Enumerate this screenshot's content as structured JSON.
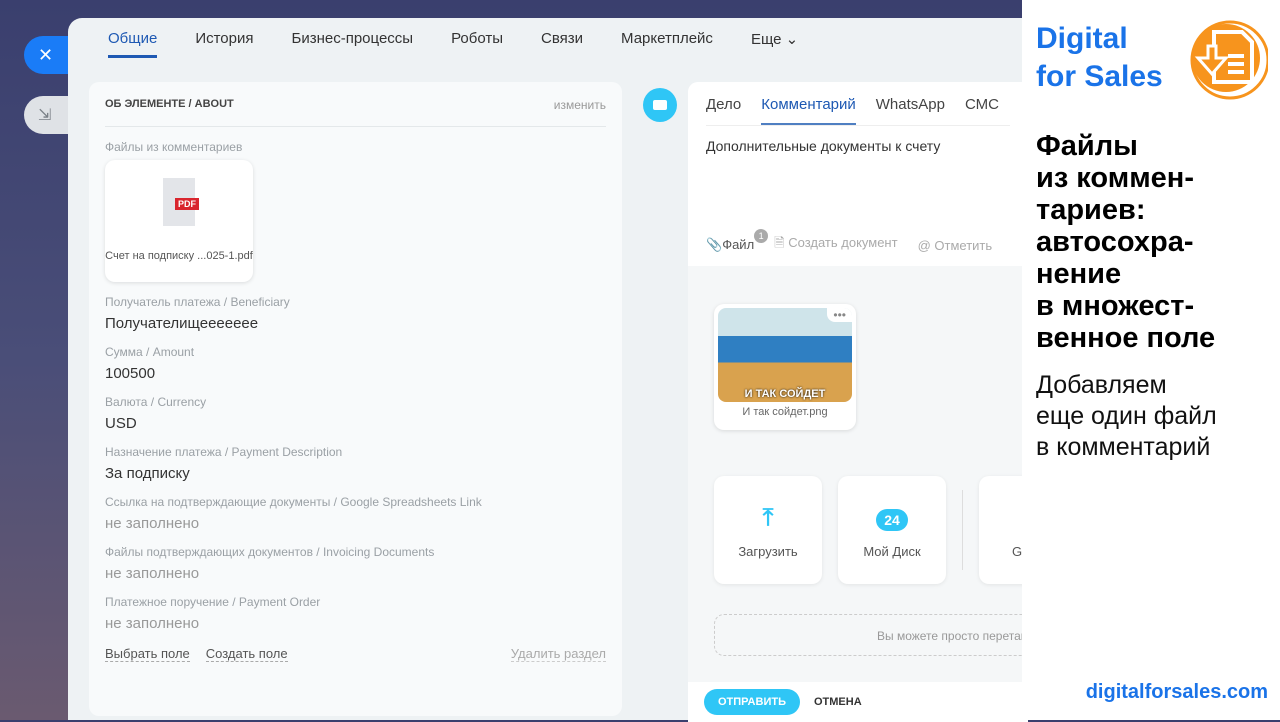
{
  "window": {
    "close_icon": "close-icon",
    "minimize_icon": "collapse-icon"
  },
  "tabs": [
    "Общие",
    "История",
    "Бизнес-процессы",
    "Роботы",
    "Связи",
    "Маркетплейс",
    "Еще"
  ],
  "about": {
    "title": "ОБ ЭЛЕМЕНТЕ / ABOUT",
    "edit": "изменить",
    "files_label": "Файлы из комментариев",
    "file_badge": "PDF",
    "file_name": "Счет на подписку ...025-1.pdf",
    "fields": [
      {
        "label": "Получатель платежа / Beneficiary",
        "value": "Получателищеееееее"
      },
      {
        "label": "Сумма / Amount",
        "value": "100500"
      },
      {
        "label": "Валюта / Currency",
        "value": "USD"
      },
      {
        "label": "Назначение платежа / Payment Description",
        "value": "За подписку"
      },
      {
        "label": "Ссылка на подтверждающие документы / Google Spreadsheets Link",
        "value": "не заполнено"
      },
      {
        "label": "Файлы подтверждающих документов / Invoicing Documents",
        "value": "не заполнено"
      },
      {
        "label": "Платежное поручение / Payment Order",
        "value": "не заполнено"
      }
    ],
    "select_field": "Выбрать поле",
    "create_field": "Создать поле",
    "delete_section": "Удалить раздел"
  },
  "editor": {
    "tabs": [
      "Дело",
      "Комментарий",
      "WhatsApp",
      "СМС"
    ],
    "active_tab": "Комментарий",
    "text": "Дополнительные документы к счету",
    "tools": {
      "file": "Файл",
      "file_count": "1",
      "create_doc": "Создать документ",
      "mention": "Отметить"
    },
    "attachment": {
      "caption": "И ТАК СОЙДЕТ",
      "name": "И так сойдет.png"
    },
    "sources": [
      "Загрузить",
      "Мой Диск",
      "Google"
    ],
    "disk_badge": "24",
    "drop_hint": "Вы можете просто перетащить файлы",
    "send": "ОТПРАВИТЬ",
    "cancel": "ОТМЕНА"
  },
  "promo": {
    "brand_line1": "Digital",
    "brand_line2": "for Sales",
    "headline": "Файлы\nиз коммен-\nтариев:\nавтосохра-\nнение\nв множест-\nвенное поле",
    "subtext": "Добавляем\nеще один файл\nв комментарий",
    "site": "digitalforsales.com",
    "brand_color": "#1a73e8",
    "logo_color": "#f7941d"
  }
}
